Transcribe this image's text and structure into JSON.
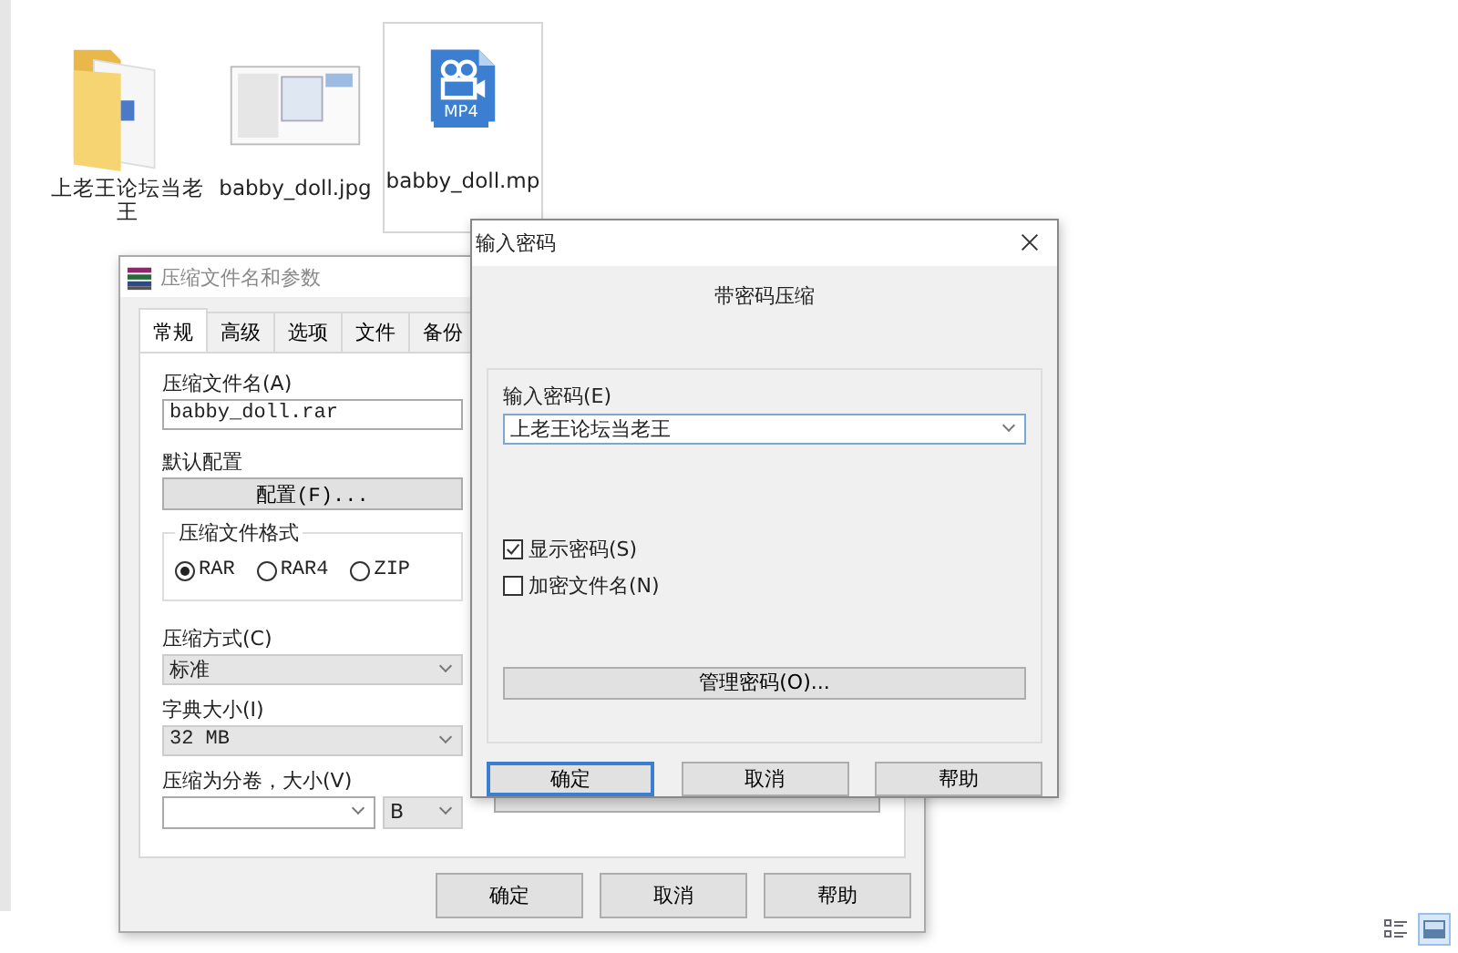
{
  "desktop_items": [
    {
      "label": "上老王论坛当老王",
      "kind": "folder",
      "selected": false
    },
    {
      "label": "babby_doll.jpg",
      "kind": "image",
      "selected": false
    },
    {
      "label": "babby_doll.mp",
      "kind": "video",
      "badge": "MP4",
      "selected": true
    }
  ],
  "archive_dialog": {
    "title": "压缩文件名和参数",
    "active": false,
    "tabs": [
      {
        "label": "常规",
        "selected": true
      },
      {
        "label": "高级",
        "selected": false
      },
      {
        "label": "选项",
        "selected": false
      },
      {
        "label": "文件",
        "selected": false
      },
      {
        "label": "备份",
        "selected": false
      }
    ],
    "archive_name_label": "压缩文件名(A)",
    "archive_name": "babby_doll.rar",
    "profile_label": "默认配置",
    "profile_button": "配置(F)...",
    "format_group": {
      "label": "压缩文件格式",
      "options": [
        {
          "label": "RAR",
          "selected": true
        },
        {
          "label": "RAR4",
          "selected": false
        },
        {
          "label": "ZIP",
          "selected": false
        }
      ]
    },
    "method": {
      "label": "压缩方式(C)",
      "value": "标准"
    },
    "dictionary": {
      "label": "字典大小(I)",
      "value": "32 MB"
    },
    "volumes": {
      "label": "压缩为分卷，大小(V)",
      "unit": "B"
    },
    "buttons": [
      "确定",
      "取消",
      "帮助"
    ]
  },
  "password_dialog": {
    "title": "输入密码",
    "heading": "带密码压缩",
    "password_label": "输入密码(E)",
    "password": "上老王论坛当老王",
    "options": [
      {
        "label": "显示密码(S)",
        "checked": true
      },
      {
        "label": "加密文件名(N)",
        "checked": false
      }
    ],
    "manage_button": "管理密码(O)...",
    "buttons": [
      {
        "label": "确定",
        "default": true
      },
      {
        "label": "取消",
        "default": false
      },
      {
        "label": "帮助",
        "default": false
      }
    ]
  },
  "view_buttons": [
    {
      "kind": "details",
      "selected": false
    },
    {
      "kind": "large_icons",
      "selected": true
    }
  ]
}
